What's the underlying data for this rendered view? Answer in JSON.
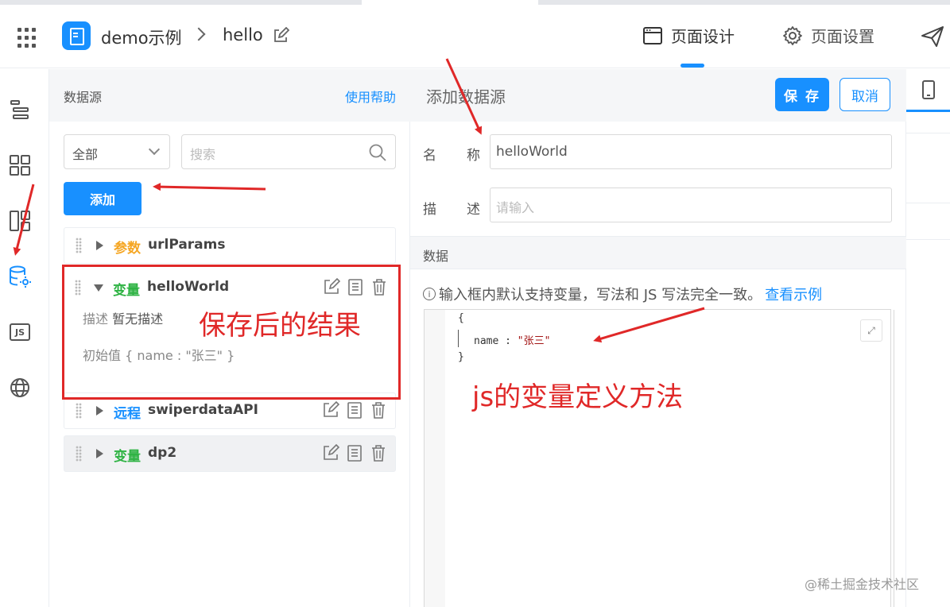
{
  "header": {
    "app_name": "demo示例",
    "page_name": "hello",
    "tabs": [
      {
        "label": "页面设计",
        "active": true
      },
      {
        "label": "页面设置",
        "active": false
      }
    ]
  },
  "rail": {
    "icons": [
      "outline-icon",
      "components-icon",
      "layout-icon",
      "datasource-icon",
      "js-icon",
      "globe-icon"
    ],
    "js_label": "JS"
  },
  "datasource_panel": {
    "title": "数据源",
    "help_link": "使用帮助",
    "filter_value": "全部",
    "search_placeholder": "搜索",
    "add_label": "添加",
    "items": [
      {
        "type": "参数",
        "type_color": "#f5a623",
        "name": "urlParams",
        "expanded": false
      },
      {
        "type": "变量",
        "type_color": "#2fb344",
        "name": "helloWorld",
        "expanded": true,
        "desc_label": "描述",
        "desc_value": "暂无描述",
        "init_label": "初始值",
        "init_value": "{ name : \"张三\" }"
      },
      {
        "type": "远程",
        "type_color": "#1890ff",
        "name": "swiperdataAPI",
        "expanded": false
      },
      {
        "type": "变量",
        "type_color": "#2fb344",
        "name": "dp2",
        "expanded": false,
        "selected": true
      }
    ]
  },
  "form_panel": {
    "title": "添加数据源",
    "save_label": "保 存",
    "cancel_label": "取消",
    "name_label_1": "名",
    "name_label_2": "称",
    "name_value": "helloWorld",
    "desc_label_1": "描",
    "desc_label_2": "述",
    "desc_placeholder": "请输入",
    "data_section_label": "数据",
    "hint_text": "输入框内默认支持变量，写法和 JS 写法完全一致。",
    "hint_link": "查看示例",
    "code": {
      "line1": "{",
      "line2_key": "name : ",
      "line2_value": "\"张三\"",
      "line3": "}"
    }
  },
  "annotations": {
    "result_note": "保存后的结果",
    "js_note": "js的变量定义方法",
    "color": "#e02828"
  },
  "watermark": "@稀土掘金技术社区",
  "colors": {
    "primary": "#1890ff",
    "annotation": "#e02828"
  }
}
